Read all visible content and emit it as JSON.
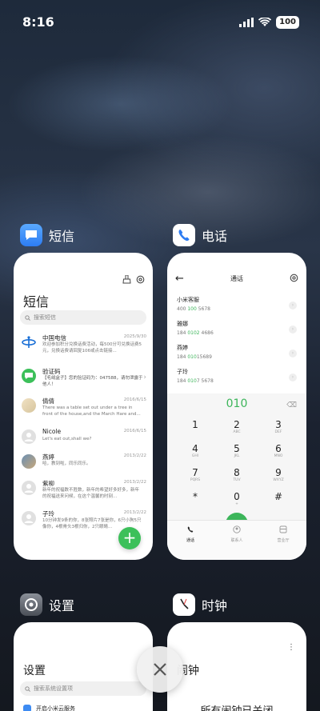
{
  "status_bar": {
    "time": "8:16",
    "battery": "100"
  },
  "apps": {
    "messages": {
      "label": "短信",
      "title": "短信",
      "search_placeholder": "搜索短信",
      "messages": [
        {
          "name": "中国电信",
          "date": "2025/9/30",
          "text": "欢迎参加积分兑换话费活动，每500分可兑换话费5元，兑换话费请回复106或点击链接..."
        },
        {
          "name": "验证码",
          "date": "",
          "text": "【毛绒盒子】您的验证码为：047588，请勿泄露于他人！"
        },
        {
          "name": "倩倩",
          "date": "2016/6/15",
          "text": "There was a table set out under a tree in front of the house,and the March Hare and..."
        },
        {
          "name": "Nicole",
          "date": "2016/6/15",
          "text": "Let's eat out,shall we?"
        },
        {
          "name": "燕婷",
          "date": "2013/2/22",
          "text": "哈，教到啦，同乐同乐。"
        },
        {
          "name": "紫柳",
          "date": "2013/2/22",
          "text": "新年的祝福数不胜数，新年的希望好多好多，新年的祝福送来问候，在这个温馨的时刻..."
        },
        {
          "name": "子玲",
          "date": "2013/2/22",
          "text": "10分钟发9条的你，8张照片7张是你，6只小狗5只像你，4根骨头3根归你，2只眼睛..."
        }
      ]
    },
    "phone": {
      "label": "电话",
      "title": "通话",
      "contacts": [
        {
          "name": "小米客服",
          "phone_pre": "400 ",
          "phone_hl": "100",
          "phone_post": " 5678"
        },
        {
          "name": "雅娜",
          "phone_pre": "184 ",
          "phone_hl": "0102",
          "phone_post": " 4686"
        },
        {
          "name": "燕婷",
          "phone_pre": "184 ",
          "phone_hl": "010",
          "phone_post": "15689"
        },
        {
          "name": "子玲",
          "phone_pre": "184 ",
          "phone_hl": "010",
          "phone_post": "7 5678"
        }
      ],
      "dialed": "010",
      "keys": [
        {
          "d": "1",
          "l": ""
        },
        {
          "d": "2",
          "l": "ABC"
        },
        {
          "d": "3",
          "l": "DEF"
        },
        {
          "d": "4",
          "l": "GHI"
        },
        {
          "d": "5",
          "l": "JKL"
        },
        {
          "d": "6",
          "l": "MNO"
        },
        {
          "d": "7",
          "l": "PQRS"
        },
        {
          "d": "8",
          "l": "TUV"
        },
        {
          "d": "9",
          "l": "WXYZ"
        },
        {
          "d": "*",
          "l": ""
        },
        {
          "d": "0",
          "l": "+"
        },
        {
          "d": "#",
          "l": ""
        }
      ],
      "tabs": [
        "通话",
        "联系人",
        "营业厅"
      ]
    },
    "settings": {
      "label": "设置",
      "title": "设置",
      "search_placeholder": "搜索系统设置项",
      "first_item": "开启小米云服务"
    },
    "clock": {
      "label": "时钟",
      "title": "闹钟",
      "empty_message": "所有闹钟已关闭"
    }
  },
  "colors": {
    "accent_green": "#3cb55a",
    "card_bg": "#ffffff"
  }
}
